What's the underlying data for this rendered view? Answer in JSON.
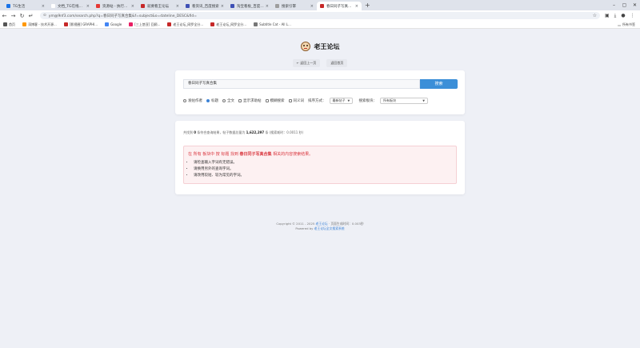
{
  "browser": {
    "tabs": [
      {
        "label": "TG生活",
        "fav_color": "#1a73e8",
        "active": false
      },
      {
        "label": "文档_TG在线调用基于TG网站",
        "fav_color": "#ffffff",
        "active": false
      },
      {
        "label": "资源站 - 执行任务解密管理 - MVC",
        "fav_color": "#e53935",
        "active": false
      },
      {
        "label": "就要看王论坛",
        "fav_color": "#c62828",
        "active": false
      },
      {
        "label": "看资讯_百度搜索",
        "fav_color": "#3f51b5",
        "active": false
      },
      {
        "label": "淘宝看板_百度搜索",
        "fav_color": "#3f51b5",
        "active": false
      },
      {
        "label": "搜索引擎",
        "fav_color": "#9e9e9e",
        "active": false
      },
      {
        "label": "春日同子写真合集 - 老王论坛",
        "fav_color": "#c62828",
        "active": true
      }
    ],
    "new_tab": "+",
    "window_controls": [
      "–",
      "▢",
      "✕"
    ],
    "url": "ym@9nf3.com/search.php?q=春日同子写真合集&f=subject&o=dateline_DESC&fid=",
    "bookmarks": [
      {
        "label": "首页",
        "fav_color": "#555555"
      },
      {
        "label": "涛博客 - 技术开源...",
        "fav_color": "#ff9800"
      },
      {
        "label": "[影视圈] GRAPHI...",
        "fav_color": "#c62828"
      },
      {
        "label": "Google",
        "fav_color": "#4285f4"
      },
      {
        "label": "[三上悠亚] 回顾...",
        "fav_color": "#e91e63"
      },
      {
        "label": "老王论坛_网罗全分...",
        "fav_color": "#c62828"
      },
      {
        "label": "老王论坛_网罗全分...",
        "fav_color": "#c62828"
      },
      {
        "label": "Subtitle Cat - All L...",
        "fav_color": "#777777"
      }
    ],
    "bookmarks_right": "所有书签"
  },
  "header": {
    "site_title": "老王论坛",
    "back_label": "← 返回上一页",
    "home_label": "返回首页"
  },
  "search": {
    "query": "春日同子写真合集",
    "button_label": "搜索",
    "options": [
      {
        "label": "发帖作者",
        "type": "radio",
        "checked": false
      },
      {
        "label": "标题",
        "type": "radio",
        "checked": true
      },
      {
        "label": "全文",
        "type": "radio",
        "checked": false
      },
      {
        "label": "显示求助帖",
        "type": "checkbox",
        "checked": false
      },
      {
        "label": "模糊搜索",
        "type": "checkbox",
        "checked": false
      },
      {
        "label": "同义词",
        "type": "checkbox",
        "checked": false
      }
    ],
    "sort_label": "排序方式：",
    "sort_value": "最新帖子",
    "section_label": "搜索板块：",
    "section_value": "所有板块"
  },
  "results": {
    "stats_prefix": "共找到",
    "found_count": "0",
    "stats_mid": "条符合查询结果，帖子数据总量为",
    "total_count": "1,622,297",
    "stats_suffix": "条 (搜索耗时：0.0011 秒)",
    "alert_prefix": "在 所有 板块中 按 标题 找到",
    "alert_term": "春日同子写真合集",
    "alert_suffix": "相关的内容搜索结果。",
    "tips": [
      "请检查输入字词有无错误。",
      "请换用另外的查询字词。",
      "请改用较短、较为常见的字词。"
    ]
  },
  "footer": {
    "copyright_prefix": "Copyright © 2011 - 2025",
    "copyright_link": "老王论坛",
    "copyright_suffix": " · 页面生成时间：0.003秒",
    "powered_prefix": "Powered by",
    "powered_link": "老王论坛全文搜索系统"
  }
}
